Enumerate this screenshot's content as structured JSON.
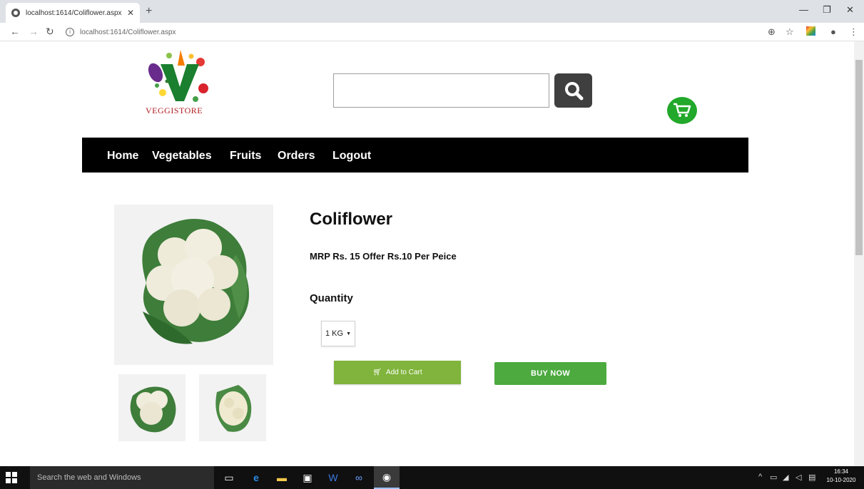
{
  "browser": {
    "tab_title": "localhost:1614/Coliflower.aspx",
    "tab_close": "✕",
    "new_tab": "+",
    "url": "localhost:1614/Coliflower.aspx",
    "icons": [
      "back-icon",
      "forward-icon",
      "reload-icon",
      "info-icon",
      "zoom-icon",
      "star-icon",
      "extension-icon",
      "profile-icon",
      "menu-icon"
    ]
  },
  "site": {
    "logo_text": "VEGGISTORE",
    "search": {
      "placeholder": ""
    },
    "nav": [
      "Home",
      "Vegetables",
      "Fruits",
      "Orders",
      "Logout"
    ],
    "colors": {
      "nav_bg": "#000000",
      "cart_green": "#22a82a",
      "addcart_green": "#80b43c",
      "buynow_green": "#4caa3f"
    }
  },
  "product": {
    "name": "Coliflower",
    "price_text": "MRP Rs. 15 Offer Rs.10 Per Peice",
    "quantity_label": "Quantity",
    "quantity_selected": "1 KG",
    "add_to_cart": "Add to Cart",
    "buy_now": "BUY NOW"
  },
  "taskbar": {
    "search_placeholder": "Search the web and Windows",
    "time": "16:34",
    "date": "10-10-2020"
  }
}
